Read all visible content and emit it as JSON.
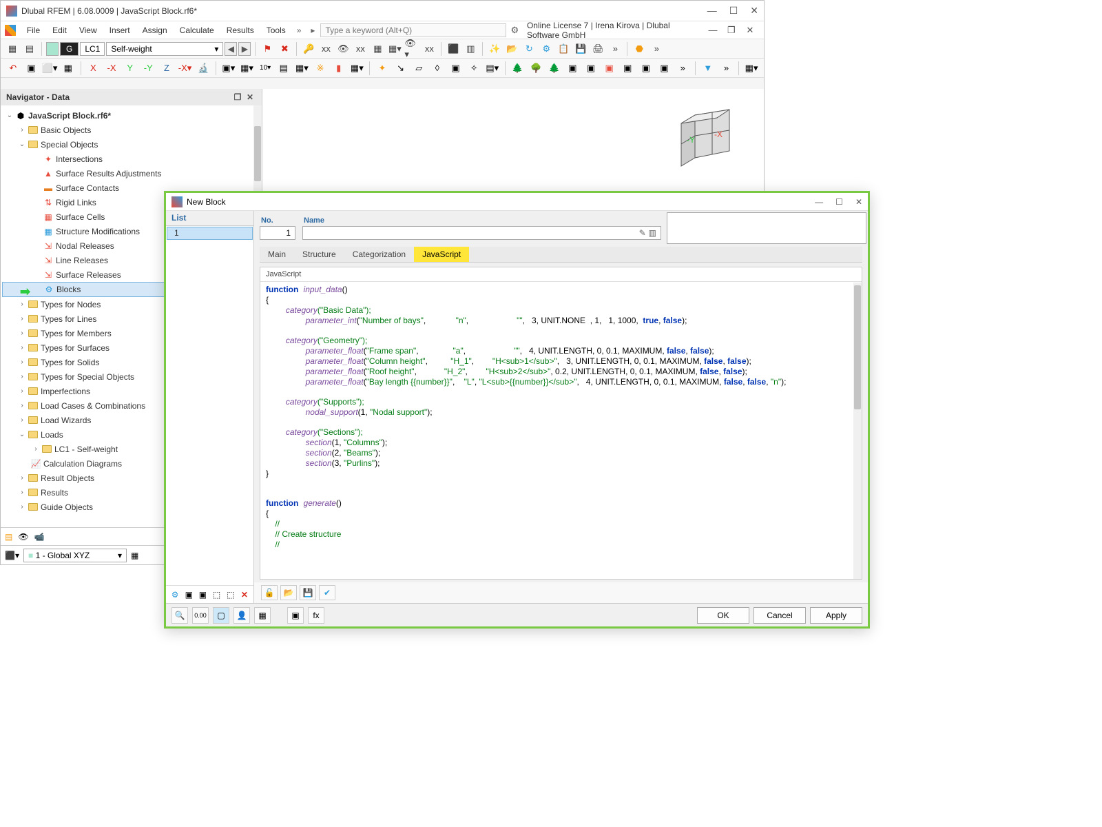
{
  "window": {
    "title": "Dlubal RFEM | 6.08.0009 | JavaScript Block.rf6*"
  },
  "menu": {
    "items": [
      "File",
      "Edit",
      "View",
      "Insert",
      "Assign",
      "Calculate",
      "Results",
      "Tools"
    ],
    "search_placeholder": "Type a keyword (Alt+Q)",
    "license": "Online License 7 | Irena Kirova | Dlubal Software GmbH"
  },
  "lc": {
    "g": "G",
    "id": "LC1",
    "name": "Self-weight"
  },
  "navigator": {
    "title": "Navigator - Data",
    "root": "JavaScript Block.rf6*",
    "basic": "Basic Objects",
    "special": "Special Objects",
    "special_items": [
      "Intersections",
      "Surface Results Adjustments",
      "Surface Contacts",
      "Rigid Links",
      "Surface Cells",
      "Structure Modifications",
      "Nodal Releases",
      "Line Releases",
      "Surface Releases",
      "Blocks"
    ],
    "folders": [
      "Types for Nodes",
      "Types for Lines",
      "Types for Members",
      "Types for Surfaces",
      "Types for Solids",
      "Types for Special Objects",
      "Imperfections",
      "Load Cases & Combinations",
      "Load Wizards"
    ],
    "loads": "Loads",
    "lc1": "LC1 - Self-weight",
    "calc": "Calculation Diagrams",
    "more": [
      "Result Objects",
      "Results",
      "Guide Objects"
    ],
    "coord": "1 - Global XYZ"
  },
  "dialog": {
    "title": "New Block",
    "list_hdr": "List",
    "list_item": "1",
    "no_label": "No.",
    "no_value": "1",
    "name_label": "Name",
    "tabs": [
      "Main",
      "Structure",
      "Categorization",
      "JavaScript"
    ],
    "code_hdr": "JavaScript",
    "ok": "OK",
    "cancel": "Cancel",
    "apply": "Apply"
  },
  "code": {
    "l1a": "function",
    "l1b": "input_data",
    "l1c": "()",
    "l2": "{",
    "l3a": "category",
    "l3b": "(\"Basic Data\");",
    "l4a": "parameter_int",
    "l4b": "(",
    "l4s": "\"Number of bays\"",
    "l4c": ",             ",
    "l4s2": "\"n\"",
    "l4d": ",                     ",
    "l4s3": "\"\"",
    "l4e": ",   3, UNIT.NONE  , 1,   1, 1000,  ",
    "l4t": "true",
    "l4f": ", ",
    "l4g": "false",
    "l4h": ");",
    "l5a": "category",
    "l5b": "(\"Geometry\");",
    "l6a": "parameter_float",
    "l6b": "(",
    "l6s": "\"Frame span\"",
    "l6c": ",               ",
    "l6s2": "\"a\"",
    "l6d": ",                     ",
    "l6s3": "\"\"",
    "l6e": ",   4, UNIT.LENGTH, 0, 0.1, MAXIMUM, ",
    "l6f": "false",
    "l6g": ", ",
    "l6h": "false",
    "l6i": ");",
    "l7a": "parameter_float",
    "l7b": "(",
    "l7s": "\"Column height\"",
    "l7c": ",          ",
    "l7s2": "\"H_1\"",
    "l7d": ",        ",
    "l7s3": "\"H<sub>1</sub>\"",
    "l7e": ",   3, UNIT.LENGTH, 0, 0.1, MAXIMUM, ",
    "l7f": "false",
    "l7g": ", ",
    "l7h": "false",
    "l7i": ");",
    "l8a": "parameter_float",
    "l8b": "(",
    "l8s": "\"Roof height\"",
    "l8c": ",            ",
    "l8s2": "\"H_2\"",
    "l8d": ",        ",
    "l8s3": "\"H<sub>2</sub>\"",
    "l8e": ", 0.2, UNIT.LENGTH, 0, 0.1, MAXIMUM, ",
    "l8f": "false",
    "l8g": ", ",
    "l8h": "false",
    "l8i": ");",
    "l9a": "parameter_float",
    "l9b": "(",
    "l9s": "\"Bay length {{number}}\"",
    "l9c": ",    ",
    "l9s2": "\"L\"",
    "l9d": ", ",
    "l9s3": "\"L<sub>{{number}}</sub>\"",
    "l9e": ",   4, UNIT.LENGTH, 0, 0.1, MAXIMUM, ",
    "l9f": "false",
    "l9g": ", ",
    "l9h": "false",
    "l9i": ", ",
    "l9j": "\"n\"",
    "l9k": ");",
    "l10a": "category",
    "l10b": "(\"Supports\");",
    "l11a": "nodal_support",
    "l11b": "(1, ",
    "l11s": "\"Nodal support\"",
    "l11c": ");",
    "l12a": "category",
    "l12b": "(\"Sections\");",
    "l13a": "section",
    "l13b": "(1, ",
    "l13s": "\"Columns\"",
    "l13c": ");",
    "l14a": "section",
    "l14b": "(2, ",
    "l14s": "\"Beams\"",
    "l14c": ");",
    "l15a": "section",
    "l15b": "(3, ",
    "l15s": "\"Purlins\"",
    "l15c": ");",
    "l16": "}",
    "l17a": "function",
    "l17b": "generate",
    "l17c": "()",
    "l18": "{",
    "l19": "    //",
    "l20": "    // Create structure",
    "l21": "    //"
  }
}
